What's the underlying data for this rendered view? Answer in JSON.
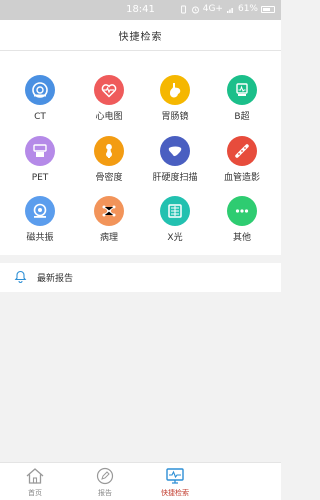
{
  "status_bar": {
    "time": "18:41",
    "network": "4G+",
    "battery": "61%"
  },
  "header": {
    "title": "快捷检索"
  },
  "grid": [
    {
      "label": "CT",
      "color": "#4a90e2",
      "icon": "ct-scanner-icon"
    },
    {
      "label": "心电图",
      "color": "#ef5b5b",
      "icon": "ecg-heart-icon"
    },
    {
      "label": "胃肠镜",
      "color": "#f5b700",
      "icon": "stomach-icon"
    },
    {
      "label": "B超",
      "color": "#1bbf8a",
      "icon": "ultrasound-monitor-icon"
    },
    {
      "label": "PET",
      "color": "#b58ae8",
      "icon": "pet-scanner-icon"
    },
    {
      "label": "骨密度",
      "color": "#f39c12",
      "icon": "bone-density-icon"
    },
    {
      "label": "肝硬度扫描",
      "color": "#4a5fc1",
      "icon": "liver-icon"
    },
    {
      "label": "血管造影",
      "color": "#e74c3c",
      "icon": "vessel-icon"
    },
    {
      "label": "磁共振",
      "color": "#5b9ded",
      "icon": "mri-icon"
    },
    {
      "label": "病理",
      "color": "#f2945a",
      "icon": "pathology-molecule-icon"
    },
    {
      "label": "X光",
      "color": "#22c1b0",
      "icon": "xray-icon"
    },
    {
      "label": "其他",
      "color": "#2ecc71",
      "icon": "more-dots-icon"
    }
  ],
  "reports": {
    "label": "最新报告",
    "icon": "bell-icon"
  },
  "tabbar": {
    "tabs": [
      {
        "label": "首页",
        "icon": "home-icon",
        "active": false
      },
      {
        "label": "报告",
        "icon": "pencil-icon",
        "active": false
      },
      {
        "label": "快捷检索",
        "icon": "monitor-icon",
        "active": true
      }
    ]
  },
  "colors": {
    "accent": "#c0392b",
    "tab_active_icon": "#2d8fd5"
  }
}
